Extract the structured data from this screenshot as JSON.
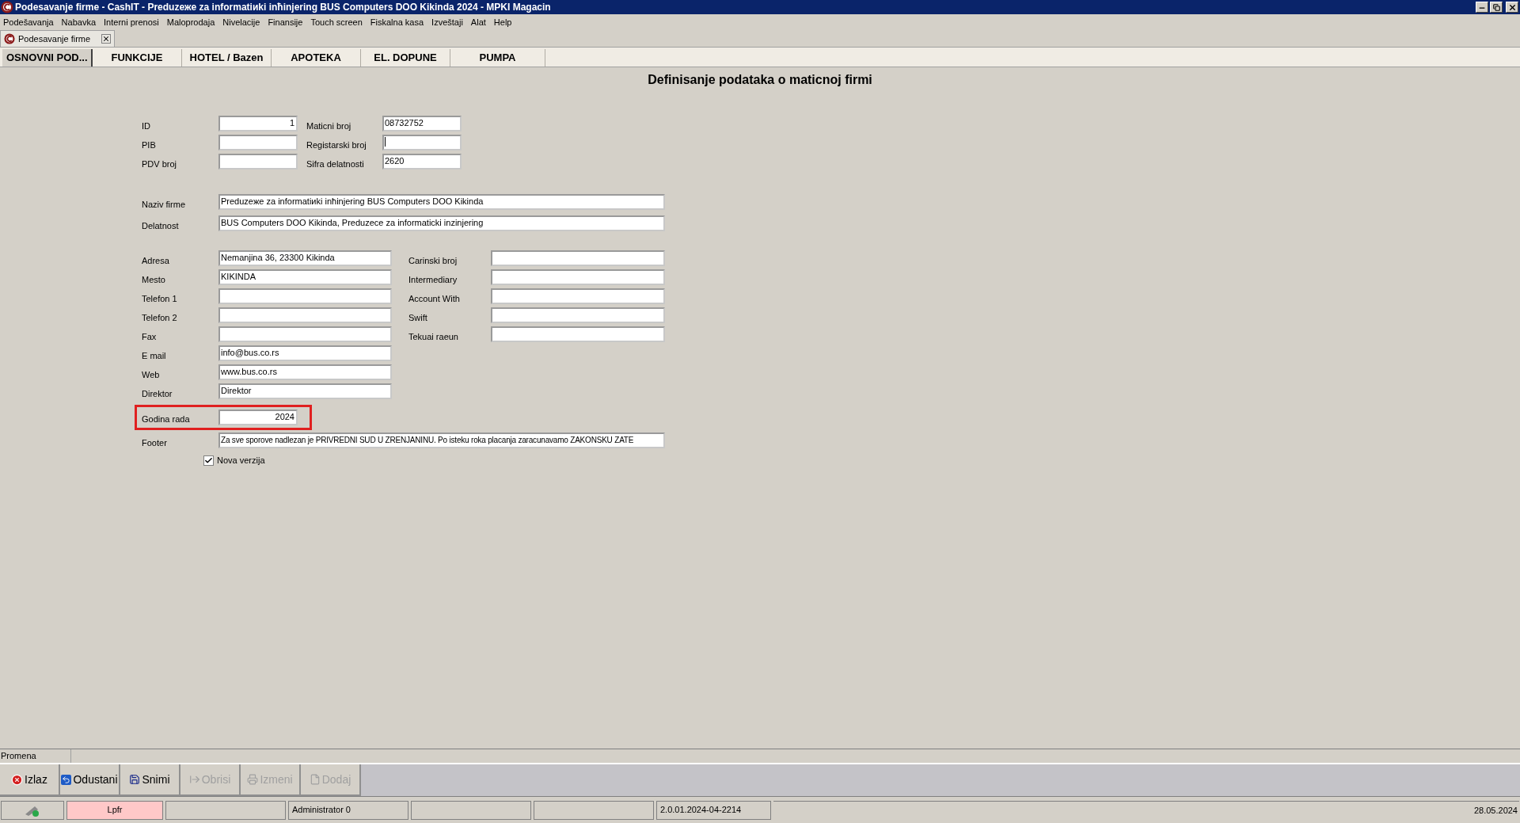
{
  "window": {
    "title": "Podesavanje firme - CashIT - Preduzeжe za informatiиki inћinjering BUS Computers DOO Kikinda 2024 - MPKI Magacin"
  },
  "menu": [
    "Podešavanja",
    "Nabavka",
    "Interni prenosi",
    "Maloprodaja",
    "Nivelacije",
    "Finansije",
    "Touch screen",
    "Fiskalna kasa",
    "Izveštaji",
    "Alat",
    "Help"
  ],
  "document_tab": {
    "label": "Podesavanje firme"
  },
  "tabs": [
    {
      "label": "OSNOVNI POD...",
      "selected": true
    },
    {
      "label": "FUNKCIJE",
      "selected": false
    },
    {
      "label": "HOTEL / Bazen",
      "selected": false
    },
    {
      "label": "APOTEKA",
      "selected": false
    },
    {
      "label": "EL. DOPUNE",
      "selected": false
    },
    {
      "label": "PUMPA",
      "selected": false
    }
  ],
  "heading": "Definisanje podataka o maticnoj firmi",
  "identity_rows": [
    {
      "left": {
        "label": "ID",
        "value": "1"
      },
      "right": {
        "label": "Maticni broj",
        "value": "08732752"
      }
    },
    {
      "left": {
        "label": "PIB"
      },
      "right": {
        "label": "Registarski broj",
        "focused": true
      }
    },
    {
      "left": {
        "label": "PDV broj"
      },
      "right": {
        "label": "Sifra delatnosti",
        "value": "2620"
      }
    }
  ],
  "name_rows": [
    {
      "label": "Naziv firme",
      "value": "Preduzeжe za informatiиki inћinjering BUS Computers DOO Kikinda"
    },
    {
      "label": "Delatnost",
      "value": "BUS Computers DOO Kikinda, Preduzece za informaticki inzinjering"
    }
  ],
  "contact_rows": [
    {
      "left": {
        "label": "Adresa",
        "value": "Nemanjina 36, 23300 Kikinda"
      },
      "right": {
        "label": "Carinski broj"
      }
    },
    {
      "left": {
        "label": "Mesto",
        "value": "KIKINDA"
      },
      "right": {
        "label": "Intermediary"
      }
    },
    {
      "left": {
        "label": "Telefon 1"
      },
      "right": {
        "label": "Account With"
      }
    },
    {
      "left": {
        "label": "Telefon 2"
      },
      "right": {
        "label": "Swift"
      }
    },
    {
      "left": {
        "label": "Fax"
      },
      "right": {
        "label": "Tekuai raeun"
      }
    },
    {
      "left": {
        "label": "E mail",
        "value": "info@bus.co.rs"
      }
    },
    {
      "left": {
        "label": "Web",
        "value": "www.bus.co.rs"
      }
    },
    {
      "left": {
        "label": "Direktor",
        "value": "Direktor"
      }
    }
  ],
  "year_row": {
    "label": "Godina rada",
    "value": "2024",
    "highlighted": true
  },
  "footer_row": {
    "label": "Footer",
    "value": "Za sve sporove nadlezan je PRIVREDNI SUD U ZRENJANINU. Po isteku roka placanja zaracunavamo ZAKONSKU ZATE"
  },
  "checkbox": {
    "label": "Nova verzija",
    "checked": true
  },
  "mode_label": "Promena",
  "buttons": [
    {
      "label": "Izlaz",
      "kind": "exit",
      "disabled": false
    },
    {
      "label": "Odustani",
      "kind": "cancel",
      "disabled": false
    },
    {
      "label": "Snimi",
      "kind": "save",
      "disabled": false
    },
    {
      "label": "Obrisi",
      "kind": "delete",
      "disabled": true
    },
    {
      "label": "Izmeni",
      "kind": "edit",
      "disabled": true
    },
    {
      "label": "Dodaj",
      "kind": "add",
      "disabled": true
    }
  ],
  "status_bar": [
    {
      "kind": "icon"
    },
    {
      "kind": "text",
      "text": "Lpfr",
      "color": "#ffc8c8"
    },
    {
      "kind": "empty"
    },
    {
      "kind": "text",
      "text": "Administrator 0"
    },
    {
      "kind": "empty"
    },
    {
      "kind": "empty"
    },
    {
      "kind": "text",
      "text": "2.0.01.2024-04-2214"
    },
    {
      "kind": "date",
      "text": "28.05.2024"
    }
  ]
}
